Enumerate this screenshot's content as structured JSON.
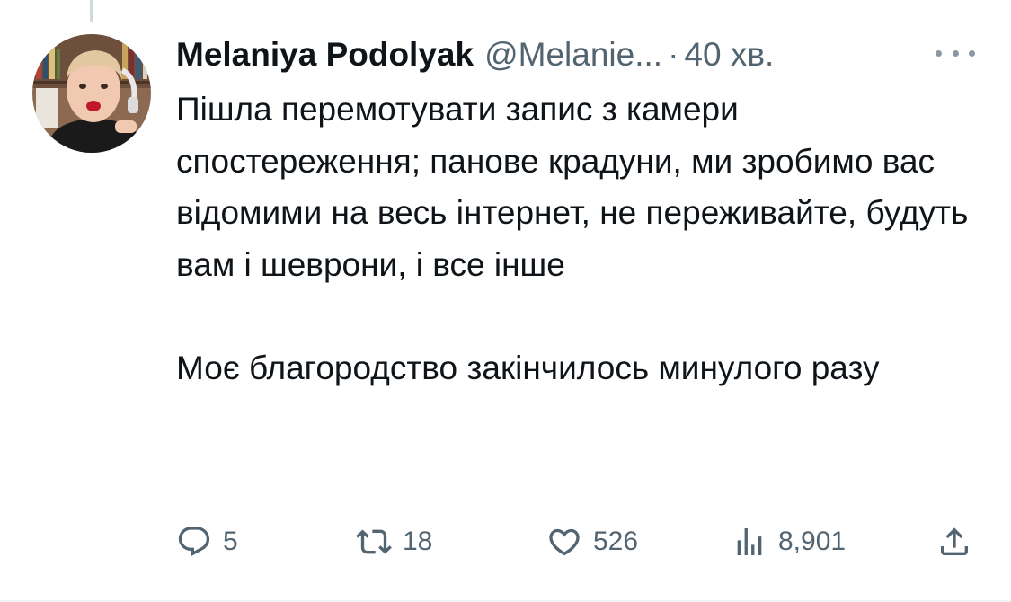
{
  "tweet": {
    "display_name": "Melaniya Podolyak",
    "handle": "@Melanie...",
    "separator": "·",
    "time": "40 хв.",
    "paragraphs": [
      "Пішла перемотувати запис з камери спостереження; панове крадуни, ми зробимо вас відомими на весь інтернет, не переживайте, будуть вам і шеврони, і все інше",
      "Моє благородство закінчилось минулого разу"
    ]
  },
  "actions": {
    "replies": "5",
    "retweets": "18",
    "likes": "526",
    "views": "8,901"
  },
  "icons": {
    "reply": "reply-icon",
    "retweet": "retweet-icon",
    "like": "heart-icon",
    "views": "views-icon",
    "share": "share-icon",
    "more": "more-icon"
  },
  "colors": {
    "text": "#0f1419",
    "secondary": "#536471",
    "thread_line": "#cfd9de"
  }
}
